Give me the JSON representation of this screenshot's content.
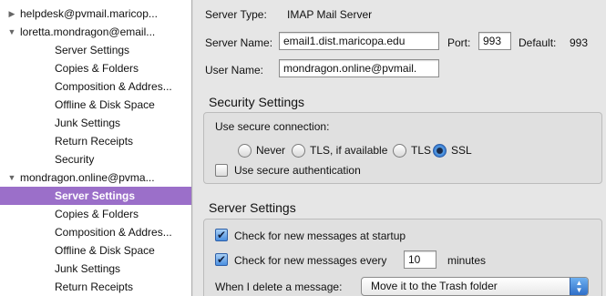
{
  "sidebar": {
    "accounts": [
      {
        "label": "helpdesk@pvmail.maricop...",
        "expanded": false,
        "children": []
      },
      {
        "label": "loretta.mondragon@email...",
        "expanded": true,
        "children": [
          "Server Settings",
          "Copies & Folders",
          "Composition & Addres...",
          "Offline & Disk Space",
          "Junk Settings",
          "Return Receipts",
          "Security"
        ]
      },
      {
        "label": "mondragon.online@pvma...",
        "expanded": true,
        "children": [
          "Server Settings",
          "Copies & Folders",
          "Composition & Addres...",
          "Offline & Disk Space",
          "Junk Settings",
          "Return Receipts"
        ]
      }
    ],
    "selected": "Server Settings",
    "selection_color": "#9b6fc9"
  },
  "server": {
    "type_label": "Server Type:",
    "type_value": "IMAP Mail Server",
    "name_label": "Server Name:",
    "name_value": "email1.dist.maricopa.edu",
    "port_label": "Port:",
    "port_value": "993",
    "default_label": "Default:",
    "default_value": "993",
    "user_label": "User Name:",
    "user_value": "mondragon.online@pvmail."
  },
  "security": {
    "title": "Security Settings",
    "connection_label": "Use secure connection:",
    "options": [
      "Never",
      "TLS, if available",
      "TLS",
      "SSL"
    ],
    "selected_option": "SSL",
    "secure_auth_label": "Use secure authentication",
    "secure_auth_checked": false
  },
  "server_settings": {
    "title": "Server Settings",
    "check_startup_label": "Check for new messages at startup",
    "check_startup_checked": true,
    "check_every_label": "Check for new messages every",
    "check_every_checked": true,
    "check_every_value": "10",
    "minutes_label": "minutes",
    "delete_label": "When I delete a message:",
    "delete_value": "Move it to the Trash folder"
  },
  "icons": {
    "collapsed": "▶",
    "expanded": "▼",
    "checkmark": "✔",
    "select_arrows": "▲▼"
  }
}
